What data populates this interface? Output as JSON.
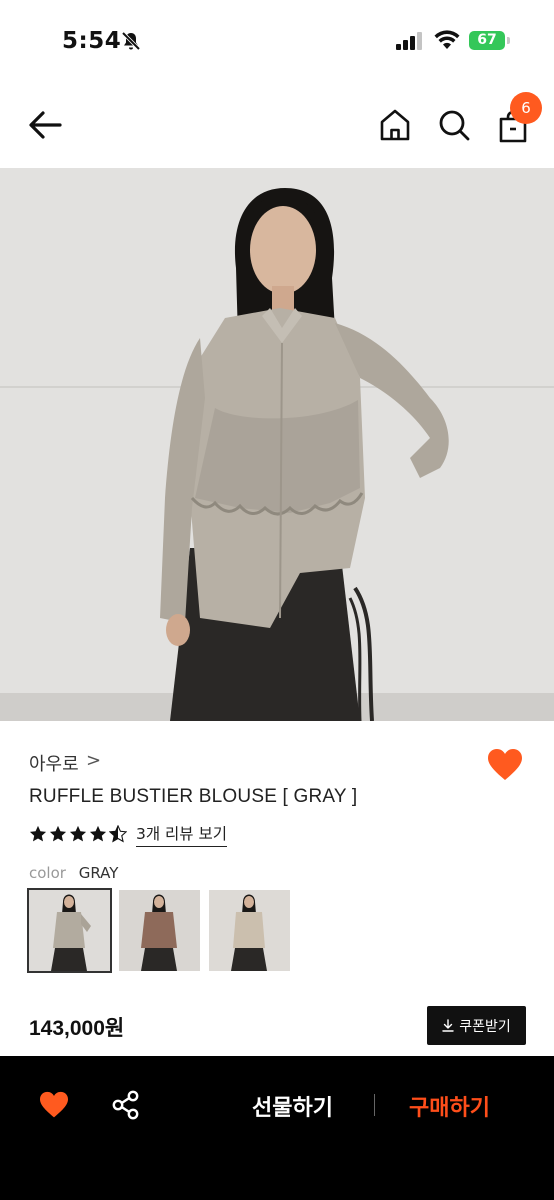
{
  "status_bar": {
    "time": "5:54",
    "battery": "67"
  },
  "header": {
    "cart_count": "6"
  },
  "product": {
    "brand": "아우로",
    "brand_chevron": ">",
    "name": "RUFFLE BUSTIER BLOUSE [ GRAY ]",
    "rating": 4.5,
    "review_link": "3개 리뷰 보기",
    "color_label": "color",
    "color_value": "GRAY",
    "swatches": [
      "gray",
      "brown",
      "beige"
    ],
    "price": "143,000원",
    "coupon_label": "쿠폰받기"
  },
  "bottom_bar": {
    "gift_label": "선물하기",
    "buy_label": "구매하기"
  },
  "colors": {
    "accent": "#ff5a1f",
    "buy": "#ff4e1a",
    "battery": "#34c759"
  }
}
